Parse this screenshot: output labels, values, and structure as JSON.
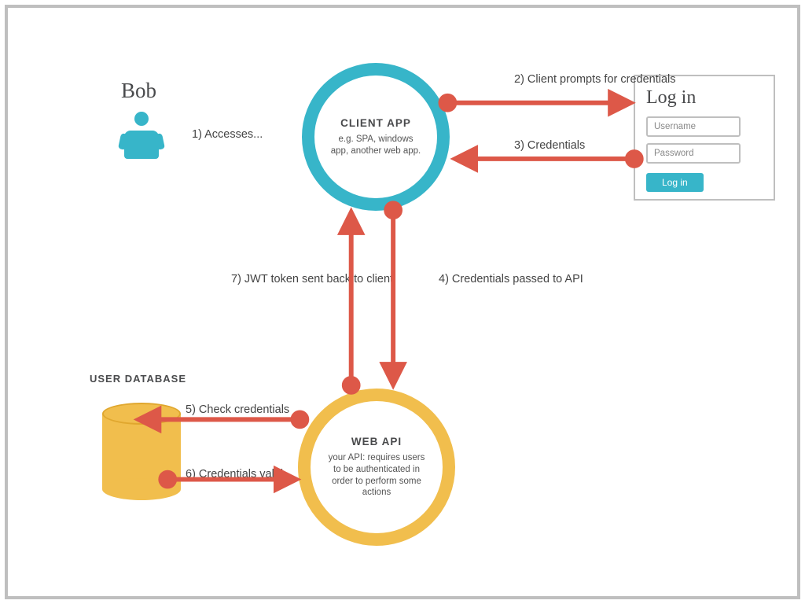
{
  "actor": {
    "name": "Bob"
  },
  "nodes": {
    "client": {
      "title": "CLIENT APP",
      "subtitle": "e.g. SPA, windows app, another web app."
    },
    "api": {
      "title": "WEB API",
      "subtitle": "your API: requires users to be authenticated in order to perform some actions"
    },
    "database": {
      "title": "USER DATABASE"
    }
  },
  "login": {
    "title": "Log in",
    "username_placeholder": "Username",
    "password_placeholder": "Password",
    "button_label": "Log in"
  },
  "steps": {
    "s1": "1) Accesses...",
    "s2": "2) Client prompts for credentials",
    "s3": "3) Credentials",
    "s4": "4) Credentials passed to API",
    "s5": "5) Check credentials",
    "s6": "6) Credentials valid",
    "s7": "7) JWT token sent back to client"
  },
  "colors": {
    "client_ring": "#37b5c9",
    "api_ring": "#f1be4d",
    "arrow": "#dd5848",
    "frame": "#bfbfbf"
  }
}
